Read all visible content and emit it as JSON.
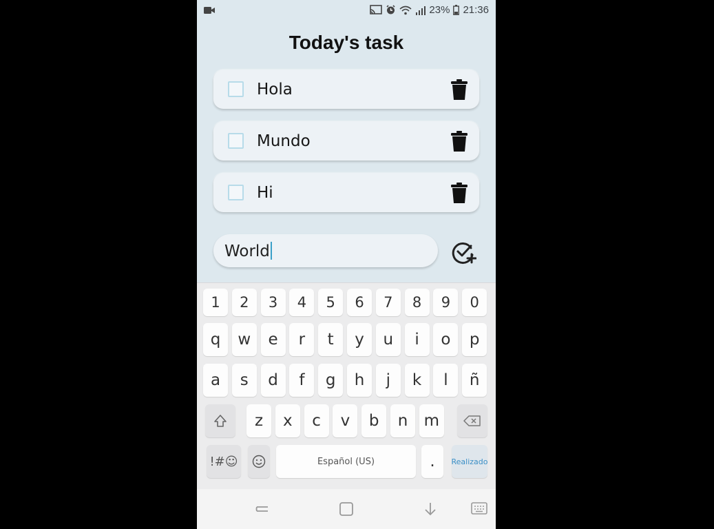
{
  "status_bar": {
    "battery_percent": "23%",
    "time": "21:36",
    "icons": [
      "video-icon",
      "cast-icon",
      "alarm-icon",
      "wifi-icon",
      "signal-icon",
      "battery-icon"
    ]
  },
  "app": {
    "title": "Today's task",
    "tasks": [
      {
        "label": "Hola",
        "done": false
      },
      {
        "label": "Mundo",
        "done": false
      },
      {
        "label": "Hi",
        "done": false
      }
    ],
    "input": {
      "value": "World"
    },
    "add_icon": "check-circle-plus-icon",
    "delete_icon": "trash-icon"
  },
  "keyboard": {
    "number_row": [
      "1",
      "2",
      "3",
      "4",
      "5",
      "6",
      "7",
      "8",
      "9",
      "0"
    ],
    "row1": [
      "q",
      "w",
      "e",
      "r",
      "t",
      "y",
      "u",
      "i",
      "o",
      "p"
    ],
    "row2": [
      "a",
      "s",
      "d",
      "f",
      "g",
      "h",
      "j",
      "k",
      "l",
      "ñ"
    ],
    "row3": [
      "z",
      "x",
      "c",
      "v",
      "b",
      "n",
      "m"
    ],
    "symbols_label": "!#☺",
    "space_label": "Español (US)",
    "period_label": ".",
    "done_label": "Realizado"
  },
  "nav_bar": {
    "icons": [
      "recents-icon",
      "home-icon",
      "back-icon",
      "keyboard-icon"
    ]
  }
}
